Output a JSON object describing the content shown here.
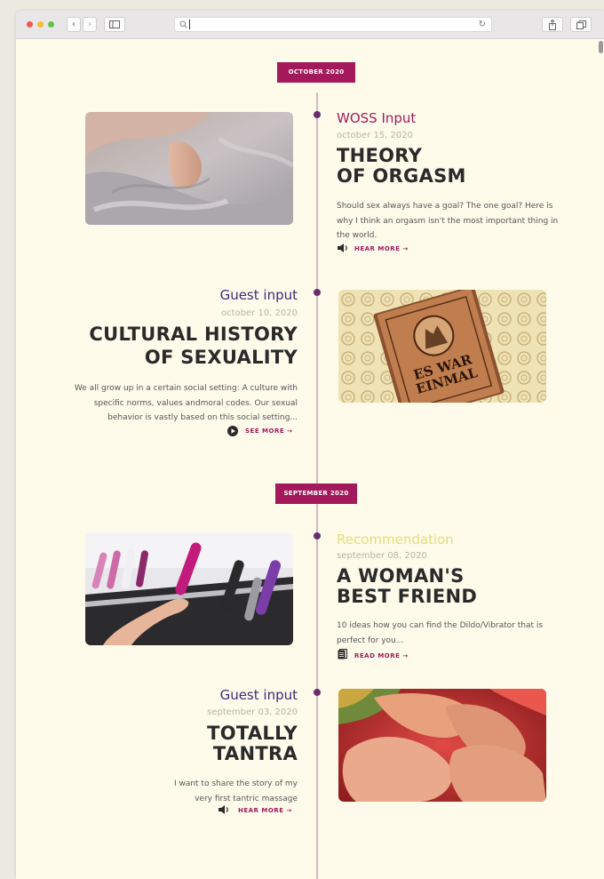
{
  "browser": {
    "address_value": "",
    "colors": {
      "red": "#ef5b55",
      "yellow": "#f3be33",
      "green": "#5fc544"
    },
    "icons": [
      "back-icon",
      "forward-icon",
      "sidebar-icon",
      "search-icon",
      "reload-icon",
      "share-icon",
      "tabs-icon"
    ]
  },
  "colors": {
    "page_bg": "#fefbeb",
    "accent": "#a3195b",
    "timeline_dot": "#6a2c6e",
    "guest_category": "#3f2a7a",
    "recommendation_category": "#e6dc7a"
  },
  "months": [
    {
      "label": "OCTOBER 2020"
    },
    {
      "label": "SEPTEMBER 2020"
    }
  ],
  "posts": [
    {
      "category": "WOSS Input",
      "date": "october 15, 2020",
      "title_line1": "THEORY",
      "title_line2": "OF ORGASM",
      "excerpt": "Should sex always have a goal? The one goal? Here is why I think an orgasm isn't the most important thing in the world.",
      "cta": "HEAR MORE →",
      "cta_icon": "speaker-icon"
    },
    {
      "category": "Guest input",
      "date": "october 10, 2020",
      "title_line1": "CULTURAL HISTORY",
      "title_line2": "OF SEXUALITY",
      "excerpt": "We all grow up in a certain social setting: A culture with specific norms, values andmoral codes. Our sexual behavior is vastly based on this social setting...",
      "cta": "SEE MORE →",
      "cta_icon": "play-icon",
      "book_text": "ES WAR EINMAL"
    },
    {
      "category": "Recommendation",
      "date": "september 08, 2020",
      "title_line1": "A WOMAN'S",
      "title_line2": "BEST FRIEND",
      "excerpt": "10 ideas how you can find the Dildo/Vibrator that is perfect for you...",
      "cta": "READ MORE →",
      "cta_icon": "document-icon"
    },
    {
      "category": "Guest input",
      "date": "september 03, 2020",
      "title_line1": "TOTALLY",
      "title_line2": "TANTRA",
      "excerpt": "I want to share the story of my very first tantric massage",
      "cta": "HEAR MORE →",
      "cta_icon": "speaker-icon"
    }
  ]
}
